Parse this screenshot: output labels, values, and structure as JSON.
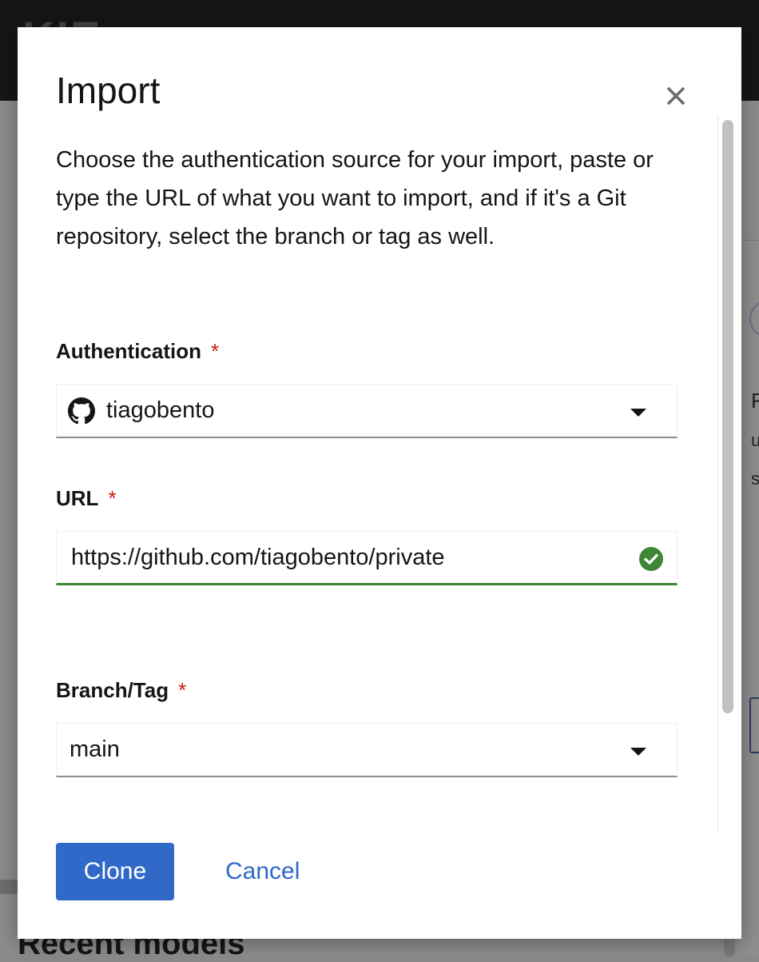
{
  "background": {
    "logo_text": "KIE",
    "peek_letters": [
      "F",
      "u",
      "s"
    ],
    "recent_heading": "Recent models"
  },
  "modal": {
    "title": "Import",
    "close_icon": "close-icon",
    "description": "Choose the authentication source for your import, paste or type the URL of what you want to import, and if it's a Git repository, select the branch or tag as well.",
    "required_marker": "*",
    "authentication": {
      "label": "Authentication",
      "value": "tiagobento",
      "icon": "github-icon"
    },
    "url": {
      "label": "URL",
      "value": "https://github.com/tiagobento/private",
      "status_icon": "check-circle-icon",
      "status_color": "#3e8635"
    },
    "branch": {
      "label": "Branch/Tag",
      "value": "main"
    },
    "footer": {
      "primary_label": "Clone",
      "secondary_label": "Cancel"
    }
  },
  "colors": {
    "primary": "#3169c8",
    "link": "#2f68c6",
    "required": "#c9190b",
    "success": "#3e8635"
  }
}
